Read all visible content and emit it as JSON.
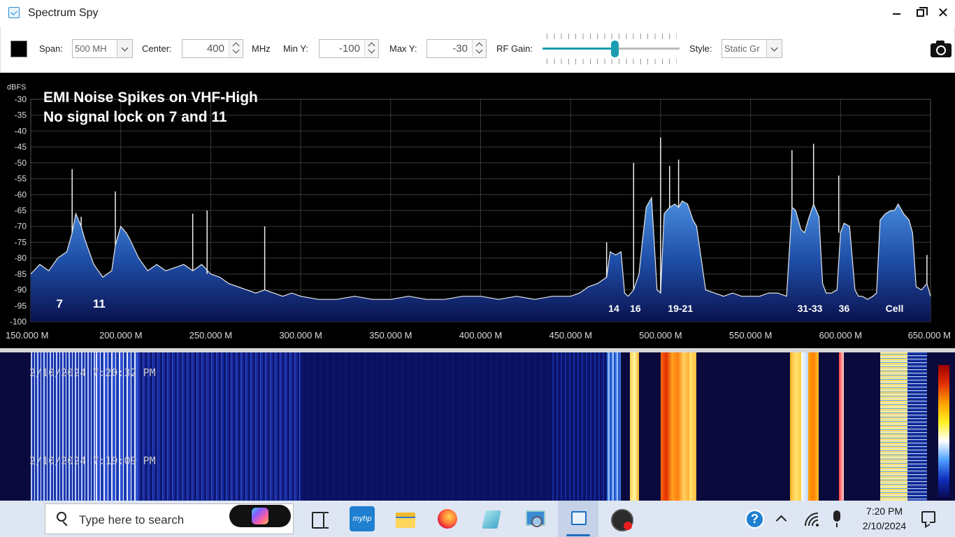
{
  "window": {
    "title": "Spectrum Spy"
  },
  "toolbar": {
    "span_label": "Span:",
    "span_value": "500 MH",
    "center_label": "Center:",
    "center_value": "400",
    "center_unit": "MHz",
    "miny_label": "Min Y:",
    "miny_value": "-100",
    "maxy_label": "Max Y:",
    "maxy_value": "-30",
    "rfgain_label": "RF Gain:",
    "rfgain_level": 0.53,
    "style_label": "Style:",
    "style_value": "Static Gr",
    "color_swatch": "#000000",
    "accent": "#1a9db0"
  },
  "annotation": {
    "line1": "EMI Noise Spikes on VHF-High",
    "line2": "No signal lock on 7 and 11"
  },
  "chart_data": {
    "type": "area",
    "ylabel": "dBFS",
    "ylim": [
      -100,
      -30
    ],
    "xlim": [
      150,
      650
    ],
    "y_ticks": [
      "-30",
      "-35",
      "-40",
      "-45",
      "-50",
      "-55",
      "-60",
      "-65",
      "-70",
      "-75",
      "-80",
      "-85",
      "-90",
      "-95",
      "-100"
    ],
    "x_ticks": [
      "150.000 M",
      "200.000 M",
      "250.000 M",
      "300.000 M",
      "350.000 M",
      "400.000 M",
      "450.000 M",
      "500.000 M",
      "550.000 M",
      "600.000 M",
      "650.000 M"
    ],
    "x": [
      150,
      155,
      160,
      165,
      170,
      173,
      175,
      178,
      180,
      185,
      190,
      195,
      197,
      199,
      200,
      203,
      205,
      210,
      215,
      220,
      225,
      230,
      235,
      240,
      245,
      250,
      255,
      260,
      265,
      270,
      275,
      280,
      285,
      290,
      295,
      300,
      310,
      320,
      330,
      340,
      350,
      360,
      370,
      380,
      390,
      400,
      410,
      420,
      430,
      440,
      450,
      455,
      460,
      465,
      470,
      472,
      475,
      478,
      480,
      482,
      485,
      488,
      490,
      492,
      495,
      498,
      500,
      502,
      505,
      508,
      510,
      512,
      515,
      518,
      520,
      525,
      530,
      535,
      540,
      545,
      550,
      555,
      560,
      565,
      570,
      573,
      575,
      578,
      580,
      582,
      585,
      588,
      590,
      592,
      595,
      598,
      600,
      602,
      605,
      608,
      610,
      612,
      615,
      618,
      620,
      622,
      625,
      628,
      630,
      632,
      635,
      638,
      640,
      642,
      645,
      648,
      650
    ],
    "y": [
      -85,
      -82,
      -84,
      -80,
      -78,
      -72,
      -66,
      -70,
      -74,
      -82,
      -86,
      -84,
      -76,
      -72,
      -70,
      -72,
      -74,
      -80,
      -84,
      -82,
      -84,
      -83,
      -82,
      -84,
      -82,
      -85,
      -86,
      -88,
      -89,
      -90,
      -91,
      -90,
      -91,
      -92,
      -91,
      -92,
      -93,
      -93,
      -92,
      -93,
      -93,
      -92,
      -93,
      -93,
      -92,
      -92,
      -93,
      -92,
      -93,
      -92,
      -92,
      -91,
      -89,
      -88,
      -86,
      -78,
      -79,
      -78,
      -91,
      -92,
      -90,
      -85,
      -74,
      -64,
      -61,
      -90,
      -91,
      -66,
      -64,
      -63,
      -64,
      -62,
      -63,
      -68,
      -70,
      -90,
      -91,
      -92,
      -91,
      -92,
      -92,
      -92,
      -91,
      -91,
      -92,
      -64,
      -65,
      -71,
      -72,
      -68,
      -63,
      -67,
      -88,
      -91,
      -91,
      -90,
      -72,
      -69,
      -70,
      -90,
      -92,
      -92,
      -93,
      -92,
      -91,
      -68,
      -66,
      -65,
      -65,
      -63,
      -66,
      -68,
      -72,
      -89,
      -90,
      -88,
      -92
    ],
    "peaks": [
      {
        "x": 173,
        "y": -52
      },
      {
        "x": 178,
        "y": -67
      },
      {
        "x": 197,
        "y": -59
      },
      {
        "x": 240,
        "y": -66
      },
      {
        "x": 248,
        "y": -65
      },
      {
        "x": 280,
        "y": -70
      },
      {
        "x": 470,
        "y": -75
      },
      {
        "x": 485,
        "y": -50
      },
      {
        "x": 500,
        "y": -42
      },
      {
        "x": 505,
        "y": -51
      },
      {
        "x": 510,
        "y": -49
      },
      {
        "x": 573,
        "y": -46
      },
      {
        "x": 585,
        "y": -44
      },
      {
        "x": 599,
        "y": -54
      },
      {
        "x": 648,
        "y": -79
      }
    ],
    "channel_labels": [
      {
        "x": 166,
        "label": "7"
      },
      {
        "x": 188,
        "label": "11"
      },
      {
        "x": 474,
        "label": "14"
      },
      {
        "x": 486,
        "label": "16"
      },
      {
        "x": 511,
        "label": "19-21"
      },
      {
        "x": 583,
        "label": "31-33"
      },
      {
        "x": 602,
        "label": "36"
      },
      {
        "x": 630,
        "label": "Cell"
      }
    ]
  },
  "waterfall": {
    "timestamps": [
      "2/10/2024 7:20:32 PM",
      "2/10/2024 7:19:09 PM"
    ]
  },
  "taskbar": {
    "search_placeholder": "Type here to search",
    "hp_label": "myhp",
    "time": "7:20 PM",
    "date": "2/10/2024"
  }
}
